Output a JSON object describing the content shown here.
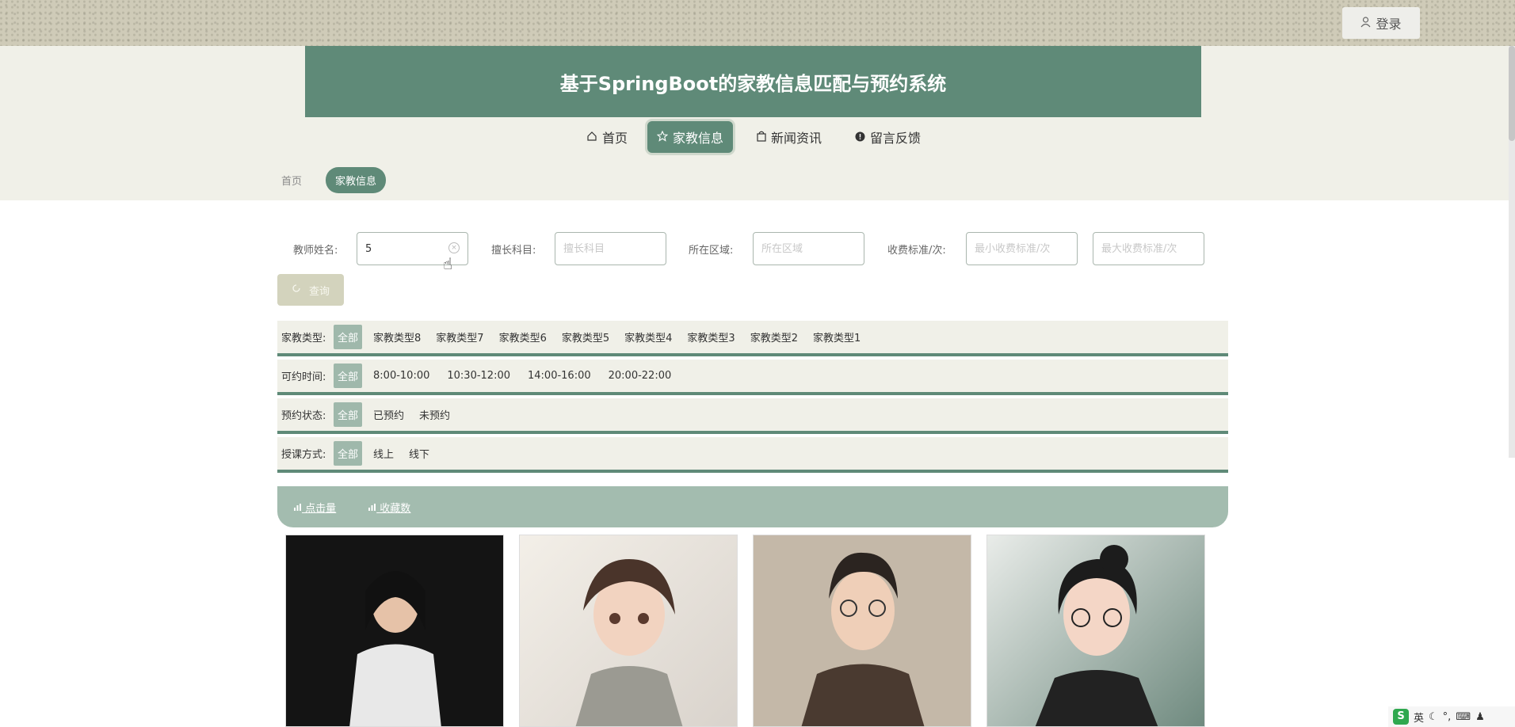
{
  "header": {
    "login_label": "登录"
  },
  "banner": {
    "title": "基于SpringBoot的家教信息匹配与预约系统"
  },
  "nav": [
    {
      "label": "首页",
      "icon": "home-icon"
    },
    {
      "label": "家教信息",
      "icon": "star-icon",
      "active": true
    },
    {
      "label": "新闻资讯",
      "icon": "bag-icon"
    },
    {
      "label": "留言反馈",
      "icon": "info-icon"
    }
  ],
  "breadcrumb": {
    "home": "首页",
    "current": "家教信息"
  },
  "search": {
    "teacher_label": "教师姓名:",
    "teacher_value": "5",
    "subject_label": "擅长科目:",
    "subject_placeholder": "擅长科目",
    "region_label": "所在区域:",
    "region_placeholder": "所在区域",
    "fee_label": "收费标准/次:",
    "fee_min_placeholder": "最小收费标准/次",
    "fee_max_placeholder": "最大收费标准/次",
    "query_label": "查询"
  },
  "filters": {
    "type": {
      "label": "家教类型:",
      "options": [
        "全部",
        "家教类型8",
        "家教类型7",
        "家教类型6",
        "家教类型5",
        "家教类型4",
        "家教类型3",
        "家教类型2",
        "家教类型1"
      ]
    },
    "time": {
      "label": "可约时间:",
      "options": [
        "全部",
        "8:00-10:00",
        "10:30-12:00",
        "14:00-16:00",
        "20:00-22:00"
      ]
    },
    "status": {
      "label": "预约状态:",
      "options": [
        "全部",
        "已预约",
        "未预约"
      ]
    },
    "mode": {
      "label": "授课方式:",
      "options": [
        "全部",
        "线上",
        "线下"
      ]
    }
  },
  "sort": {
    "clicks": "点击量",
    "favorites": "收藏数"
  },
  "tray": {
    "ime": "英"
  },
  "colors": {
    "primary": "#5f8a78",
    "light": "#f0f0e8",
    "sortbar": "#a3bcaf"
  }
}
